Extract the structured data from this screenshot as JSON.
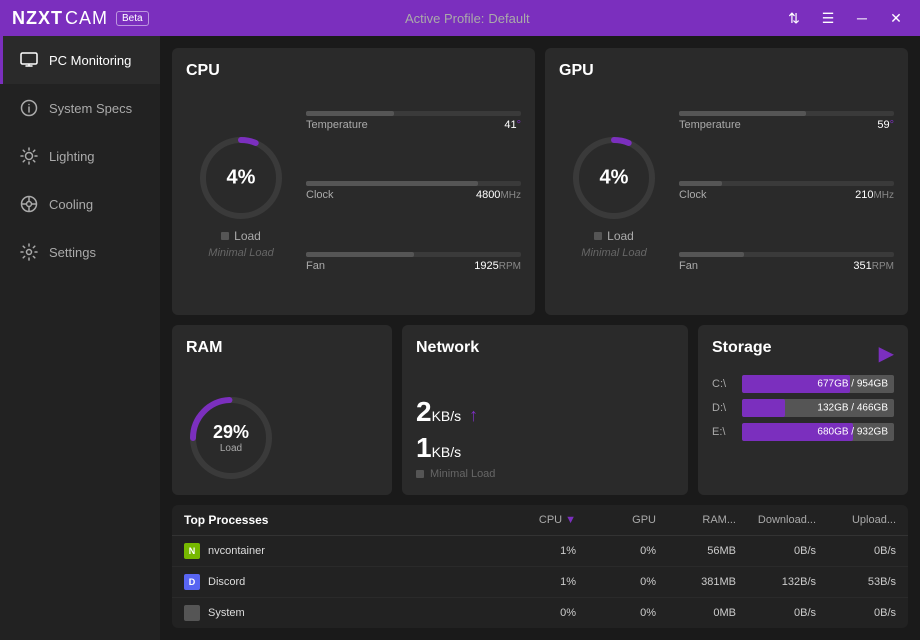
{
  "titlebar": {
    "logo": "NZXT",
    "cam": "CAM",
    "beta_label": "Beta",
    "active_profile_label": "Active Profile:",
    "profile_name": "Default"
  },
  "sidebar": {
    "items": [
      {
        "id": "pc-monitoring",
        "label": "PC Monitoring",
        "active": true,
        "icon": "monitor"
      },
      {
        "id": "system-specs",
        "label": "System Specs",
        "active": false,
        "icon": "info"
      },
      {
        "id": "lighting",
        "label": "Lighting",
        "active": false,
        "icon": "sun"
      },
      {
        "id": "cooling",
        "label": "Cooling",
        "active": false,
        "icon": "cooling"
      },
      {
        "id": "settings",
        "label": "Settings",
        "active": false,
        "icon": "gear"
      }
    ]
  },
  "cpu": {
    "title": "CPU",
    "percent": "4%",
    "load_label": "Load",
    "minimal_load": "Minimal Load",
    "temperature_label": "Temperature",
    "temperature_value": "41",
    "temperature_unit": "°",
    "temperature_bar_pct": 41,
    "clock_label": "Clock",
    "clock_value": "4800",
    "clock_unit": "MHz",
    "clock_bar_pct": 80,
    "fan_label": "Fan",
    "fan_value": "1925",
    "fan_unit": "RPM",
    "fan_bar_pct": 50,
    "gauge_pct": 4
  },
  "gpu": {
    "title": "GPU",
    "percent": "4%",
    "load_label": "Load",
    "minimal_load": "Minimal Load",
    "temperature_label": "Temperature",
    "temperature_value": "59",
    "temperature_unit": "°",
    "temperature_bar_pct": 59,
    "clock_label": "Clock",
    "clock_value": "210",
    "clock_unit": "MHz",
    "clock_bar_pct": 20,
    "fan_label": "Fan",
    "fan_value": "351",
    "fan_unit": "RPM",
    "fan_bar_pct": 30,
    "gauge_pct": 4
  },
  "ram": {
    "title": "RAM",
    "percent": "29%",
    "load_label": "Load",
    "gauge_pct": 29
  },
  "network": {
    "title": "Network",
    "download_speed": "2",
    "download_unit": "KB/s",
    "upload_speed": "1",
    "upload_unit": "KB/s",
    "minimal_load": "Minimal Load"
  },
  "storage": {
    "title": "Storage",
    "drives": [
      {
        "label": "C:\\",
        "used": 677,
        "total": 954,
        "display": "677GB / 954GB",
        "pct": 71
      },
      {
        "label": "D:\\",
        "used": 132,
        "total": 466,
        "display": "132GB / 466GB",
        "pct": 28
      },
      {
        "label": "E:\\",
        "used": 680,
        "total": 932,
        "display": "680GB / 932GB",
        "pct": 73
      }
    ]
  },
  "processes": {
    "title": "Top Processes",
    "columns": [
      "CPU",
      "GPU",
      "RAM...",
      "Download...",
      "Upload..."
    ],
    "rows": [
      {
        "icon": "nvidia",
        "name": "nvcontainer",
        "cpu": "1%",
        "gpu": "0%",
        "ram": "56MB",
        "download": "0B/s",
        "upload": "0B/s"
      },
      {
        "icon": "discord",
        "name": "Discord",
        "cpu": "1%",
        "gpu": "0%",
        "ram": "381MB",
        "download": "132B/s",
        "upload": "53B/s"
      },
      {
        "icon": "none",
        "name": "System",
        "cpu": "0%",
        "gpu": "0%",
        "ram": "0MB",
        "download": "0B/s",
        "upload": "0B/s"
      }
    ]
  }
}
